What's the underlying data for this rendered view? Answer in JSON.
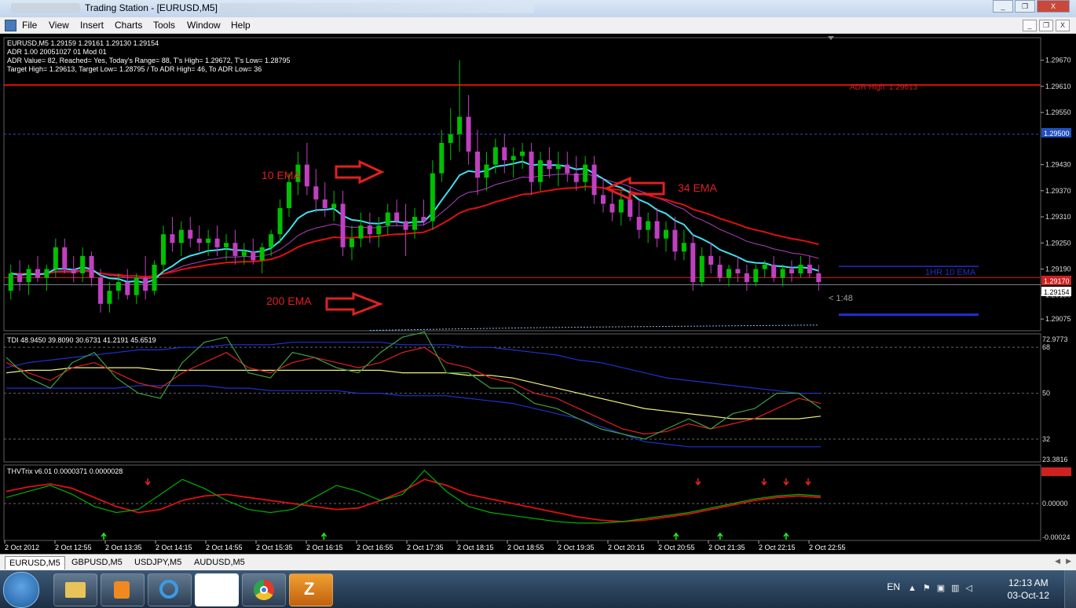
{
  "window": {
    "title": "Trading Station - [EURUSD,M5]",
    "buttons": [
      "_",
      "❐",
      "X"
    ]
  },
  "menu": [
    "File",
    "View",
    "Insert",
    "Charts",
    "Tools",
    "Window",
    "Help"
  ],
  "mdi_buttons": [
    "_",
    "❐",
    "X"
  ],
  "colors": {
    "bg": "#000000",
    "bull": "#00c000",
    "bear": "#c040c0",
    "ema10": "#40e0f0",
    "ema34": "#e01010",
    "ema200": "#80c0ff",
    "adr": "#e01010",
    "tdi_blue": "#2030d0",
    "tdi_yellow": "#f0f080",
    "tdi_red": "#e02020",
    "tdi_green": "#40a040",
    "trix_green": "#00b000",
    "trix_red": "#e01010"
  },
  "chart_data": [
    {
      "type": "candlestick",
      "header": [
        "EURUSD,M5  1.29159 1.29161 1.29130 1.29154",
        "ADR 1.00 20051027 01 Mod 01",
        "ADR Value= 82, Reached= Yes, Today's Range= 88, T's High= 1.29672, T's Low= 1.28795",
        "Target High= 1.29613, Target Low= 1.28795 / To ADR High= 46, To ADR Low= 36"
      ],
      "ylim": [
        1.2905,
        1.2972
      ],
      "yticks": [
        "1.29670",
        "1.29610",
        "1.29550",
        "1.29500",
        "1.29430",
        "1.29370",
        "1.29310",
        "1.29250",
        "1.29190",
        "1.29154",
        "1.29130",
        "1.29075"
      ],
      "price_labels": {
        "dashed_level": "1.29500",
        "red_level": "1.29170",
        "current": "1.29154"
      },
      "levels": {
        "adr_high": 1.29613,
        "dashed": 1.295,
        "red": 1.2917,
        "current": 1.29154
      },
      "annotations": {
        "adr_high": "ADR High: 1.29613",
        "hr10": "1HR 10 EMA",
        "ema10": "10 EMA",
        "ema34": "34 EMA",
        "ema200": "200 EMA",
        "countdown": "< 1:48"
      },
      "candles": [
        [
          1.2914,
          1.292,
          1.2912,
          1.2918
        ],
        [
          1.2918,
          1.2921,
          1.2914,
          1.2916
        ],
        [
          1.2916,
          1.292,
          1.2913,
          1.2919
        ],
        [
          1.2919,
          1.2922,
          1.2916,
          1.2917
        ],
        [
          1.2917,
          1.292,
          1.2914,
          1.2919
        ],
        [
          1.2919,
          1.2926,
          1.2917,
          1.2924
        ],
        [
          1.2924,
          1.2926,
          1.2918,
          1.2919
        ],
        [
          1.2919,
          1.2922,
          1.2916,
          1.2918
        ],
        [
          1.2918,
          1.2924,
          1.2916,
          1.2922
        ],
        [
          1.2922,
          1.2923,
          1.2915,
          1.2917
        ],
        [
          1.2917,
          1.2919,
          1.2909,
          1.2911
        ],
        [
          1.2911,
          1.2916,
          1.2909,
          1.2914
        ],
        [
          1.2914,
          1.2918,
          1.2912,
          1.2916
        ],
        [
          1.2916,
          1.2919,
          1.2912,
          1.2913
        ],
        [
          1.2913,
          1.2918,
          1.2911,
          1.2917
        ],
        [
          1.2917,
          1.2922,
          1.2912,
          1.2914
        ],
        [
          1.2914,
          1.2921,
          1.2913,
          1.292
        ],
        [
          1.292,
          1.2929,
          1.2918,
          1.2927
        ],
        [
          1.2927,
          1.2931,
          1.2923,
          1.2925
        ],
        [
          1.2925,
          1.293,
          1.2922,
          1.2928
        ],
        [
          1.2928,
          1.2931,
          1.2924,
          1.2926
        ],
        [
          1.2926,
          1.2929,
          1.2923,
          1.2925
        ],
        [
          1.2925,
          1.2928,
          1.2922,
          1.2926
        ],
        [
          1.2926,
          1.2929,
          1.2922,
          1.2924
        ],
        [
          1.2924,
          1.2927,
          1.2921,
          1.2925
        ],
        [
          1.2925,
          1.2928,
          1.292,
          1.2922
        ],
        [
          1.2922,
          1.2925,
          1.292,
          1.2923
        ],
        [
          1.2923,
          1.2926,
          1.292,
          1.2921
        ],
        [
          1.2921,
          1.2925,
          1.2918,
          1.2924
        ],
        [
          1.2924,
          1.2928,
          1.2922,
          1.2927
        ],
        [
          1.2927,
          1.2935,
          1.2925,
          1.2933
        ],
        [
          1.2933,
          1.2941,
          1.2931,
          1.2939
        ],
        [
          1.2939,
          1.2946,
          1.2936,
          1.2943
        ],
        [
          1.2943,
          1.2948,
          1.2936,
          1.2938
        ],
        [
          1.2938,
          1.2942,
          1.2932,
          1.2935
        ],
        [
          1.2935,
          1.2939,
          1.2931,
          1.2933
        ],
        [
          1.2933,
          1.2937,
          1.293,
          1.2934
        ],
        [
          1.2934,
          1.2937,
          1.2922,
          1.2924
        ],
        [
          1.2924,
          1.2929,
          1.2921,
          1.2926
        ],
        [
          1.2926,
          1.2932,
          1.2924,
          1.2929
        ],
        [
          1.2929,
          1.2932,
          1.2925,
          1.2927
        ],
        [
          1.2927,
          1.2931,
          1.2924,
          1.2929
        ],
        [
          1.2929,
          1.2934,
          1.2927,
          1.2932
        ],
        [
          1.2932,
          1.2935,
          1.2929,
          1.293
        ],
        [
          1.293,
          1.2934,
          1.2922,
          1.2928
        ],
        [
          1.2928,
          1.2933,
          1.2926,
          1.2931
        ],
        [
          1.2931,
          1.2935,
          1.2929,
          1.293
        ],
        [
          1.293,
          1.2944,
          1.2928,
          1.2941
        ],
        [
          1.2941,
          1.2951,
          1.2939,
          1.2948
        ],
        [
          1.2948,
          1.2956,
          1.2944,
          1.295
        ],
        [
          1.295,
          1.2967,
          1.2946,
          1.2954
        ],
        [
          1.2954,
          1.2959,
          1.2943,
          1.2946
        ],
        [
          1.2946,
          1.2951,
          1.2936,
          1.294
        ],
        [
          1.294,
          1.2946,
          1.2937,
          1.2943
        ],
        [
          1.2943,
          1.2949,
          1.2941,
          1.2947
        ],
        [
          1.2947,
          1.295,
          1.2941,
          1.2944
        ],
        [
          1.2944,
          1.2947,
          1.294,
          1.2945
        ],
        [
          1.2945,
          1.2948,
          1.2942,
          1.2946
        ],
        [
          1.2946,
          1.2948,
          1.2936,
          1.2939
        ],
        [
          1.2939,
          1.2946,
          1.2937,
          1.2944
        ],
        [
          1.2944,
          1.2947,
          1.294,
          1.2942
        ],
        [
          1.2942,
          1.2946,
          1.2938,
          1.2943
        ],
        [
          1.2943,
          1.2946,
          1.2939,
          1.2941
        ],
        [
          1.2941,
          1.2945,
          1.2937,
          1.2939
        ],
        [
          1.2939,
          1.2945,
          1.2937,
          1.2943
        ],
        [
          1.2943,
          1.2945,
          1.2934,
          1.2936
        ],
        [
          1.2936,
          1.294,
          1.2932,
          1.2934
        ],
        [
          1.2934,
          1.2937,
          1.293,
          1.2932
        ],
        [
          1.2932,
          1.2937,
          1.2929,
          1.2935
        ],
        [
          1.2935,
          1.2938,
          1.293,
          1.2931
        ],
        [
          1.2931,
          1.2935,
          1.2926,
          1.2928
        ],
        [
          1.2928,
          1.2932,
          1.2925,
          1.293
        ],
        [
          1.293,
          1.2933,
          1.2924,
          1.2926
        ],
        [
          1.2926,
          1.293,
          1.2923,
          1.2928
        ],
        [
          1.2928,
          1.2931,
          1.2921,
          1.2923
        ],
        [
          1.2923,
          1.2928,
          1.2921,
          1.2925
        ],
        [
          1.2925,
          1.2927,
          1.2914,
          1.2916
        ],
        [
          1.2916,
          1.2924,
          1.2915,
          1.2922
        ],
        [
          1.2922,
          1.2925,
          1.2918,
          1.292
        ],
        [
          1.292,
          1.2922,
          1.2916,
          1.2917
        ],
        [
          1.2917,
          1.292,
          1.2915,
          1.2919
        ],
        [
          1.2919,
          1.2922,
          1.2916,
          1.2918
        ],
        [
          1.2918,
          1.292,
          1.2914,
          1.2916
        ],
        [
          1.2916,
          1.292,
          1.2915,
          1.2919
        ],
        [
          1.2919,
          1.2921,
          1.2917,
          1.292
        ],
        [
          1.292,
          1.2922,
          1.2916,
          1.2917
        ],
        [
          1.2917,
          1.292,
          1.2915,
          1.2919
        ],
        [
          1.2919,
          1.2921,
          1.2916,
          1.2918
        ],
        [
          1.2918,
          1.2922,
          1.2917,
          1.292
        ],
        [
          1.292,
          1.2922,
          1.2917,
          1.2918
        ],
        [
          1.2918,
          1.292,
          1.2914,
          1.2916
        ]
      ]
    },
    {
      "type": "line",
      "title": "TDI 48.9450 39.8090 30.6731 41.2191 45.6519",
      "ylim": [
        23.3816,
        72.9773
      ],
      "yticks": [
        "72.9773",
        "68",
        "50",
        "32",
        "23.3816"
      ],
      "levels": [
        68,
        50,
        32
      ],
      "series": [
        {
          "key": "upper",
          "values": [
            60,
            62,
            63,
            64,
            65,
            66,
            67,
            67,
            68,
            68,
            69,
            69,
            69,
            70,
            70,
            70,
            70,
            70,
            69,
            69,
            69,
            68,
            68,
            67,
            66,
            65,
            63,
            62,
            60,
            58,
            56,
            55,
            54,
            53,
            52,
            51,
            50,
            50
          ]
        },
        {
          "key": "mid",
          "values": [
            58,
            59,
            59,
            60,
            60,
            60,
            60,
            59,
            59,
            59,
            59,
            59,
            59,
            59,
            59,
            59,
            59,
            59,
            58,
            58,
            58,
            57,
            57,
            56,
            54,
            52,
            50,
            48,
            46,
            44,
            43,
            42,
            41,
            40,
            40,
            40,
            40,
            41
          ]
        },
        {
          "key": "lower",
          "values": [
            52,
            52,
            52,
            52,
            52,
            52,
            53,
            53,
            53,
            53,
            52,
            52,
            51,
            51,
            51,
            51,
            50,
            50,
            49,
            49,
            49,
            48,
            47,
            46,
            44,
            42,
            40,
            37,
            34,
            31,
            30,
            29,
            29,
            29,
            29,
            29,
            29,
            29
          ]
        },
        {
          "key": "rsi",
          "values": [
            62,
            58,
            55,
            60,
            62,
            58,
            54,
            52,
            58,
            62,
            66,
            60,
            58,
            62,
            64,
            62,
            60,
            62,
            66,
            68,
            62,
            60,
            56,
            54,
            50,
            48,
            44,
            40,
            36,
            34,
            35,
            38,
            36,
            38,
            40,
            44,
            48,
            46
          ]
        },
        {
          "key": "fast",
          "values": [
            64,
            56,
            52,
            62,
            66,
            56,
            50,
            48,
            62,
            70,
            72,
            58,
            56,
            66,
            64,
            60,
            58,
            66,
            72,
            74,
            58,
            58,
            52,
            52,
            46,
            44,
            40,
            36,
            34,
            32,
            36,
            40,
            36,
            42,
            44,
            50,
            50,
            44
          ]
        }
      ]
    },
    {
      "type": "line",
      "title": "THVTrix v6.01 0.0000371 0.0000028",
      "ylim": [
        -0.00024,
        0.00025
      ],
      "yticks": [
        "0.00025",
        "0.00000",
        "-0.00024"
      ],
      "series": [
        {
          "key": "red",
          "values": [
            8e-05,
            0.00011,
            0.00013,
            0.0001,
            4e-05,
            -2e-05,
            -6e-05,
            -4e-05,
            2e-05,
            5e-05,
            6e-05,
            4e-05,
            2e-05,
            0.0,
            -2e-05,
            -4e-05,
            -3e-05,
            2e-05,
            8e-05,
            0.00016,
            0.00012,
            6e-05,
            3e-05,
            0.0,
            -3e-05,
            -6e-05,
            -9e-05,
            -0.00011,
            -0.00012,
            -0.00011,
            -9e-05,
            -7e-05,
            -4e-05,
            -1e-05,
            2e-05,
            4e-05,
            5e-05,
            4e-05
          ]
        },
        {
          "key": "green",
          "values": [
            4e-05,
            8e-05,
            0.00012,
            6e-05,
            -2e-05,
            -6e-05,
            -4e-05,
            6e-05,
            0.00016,
            0.0001,
            2e-05,
            -4e-05,
            -6e-05,
            -4e-05,
            4e-05,
            0.00012,
            8e-05,
            2e-05,
            6e-05,
            0.00022,
            8e-05,
            -2e-05,
            -6e-05,
            -8e-05,
            -0.0001,
            -0.00012,
            -0.00013,
            -0.00013,
            -0.00012,
            -0.0001,
            -8e-05,
            -6e-05,
            -3e-05,
            0.0,
            3e-05,
            5e-05,
            6e-05,
            5e-05
          ]
        }
      ],
      "signals": {
        "down": [
          5,
          30,
          33,
          34,
          35
        ],
        "up": [
          3,
          13,
          29,
          31,
          34
        ]
      }
    }
  ],
  "time_axis": [
    "2 Oct 2012",
    "2 Oct 12:55",
    "2 Oct 13:35",
    "2 Oct 14:15",
    "2 Oct 14:55",
    "2 Oct 15:35",
    "2 Oct 16:15",
    "2 Oct 16:55",
    "2 Oct 17:35",
    "2 Oct 18:15",
    "2 Oct 18:55",
    "2 Oct 19:35",
    "2 Oct 20:15",
    "2 Oct 20:55",
    "2 Oct 21:35",
    "2 Oct 22:15",
    "2 Oct 22:55"
  ],
  "tabs": [
    "EURUSD,M5",
    "GBPUSD,M5",
    "USDJPY,M5",
    "AUDUSD,M5"
  ],
  "taskbar": {
    "apps": [
      "folder-icon",
      "media-icon",
      "ie-icon",
      "blank-window",
      "chrome-icon",
      "winrar-icon"
    ],
    "lang": "EN",
    "time": "12:13 AM",
    "date": "03-Oct-12"
  }
}
